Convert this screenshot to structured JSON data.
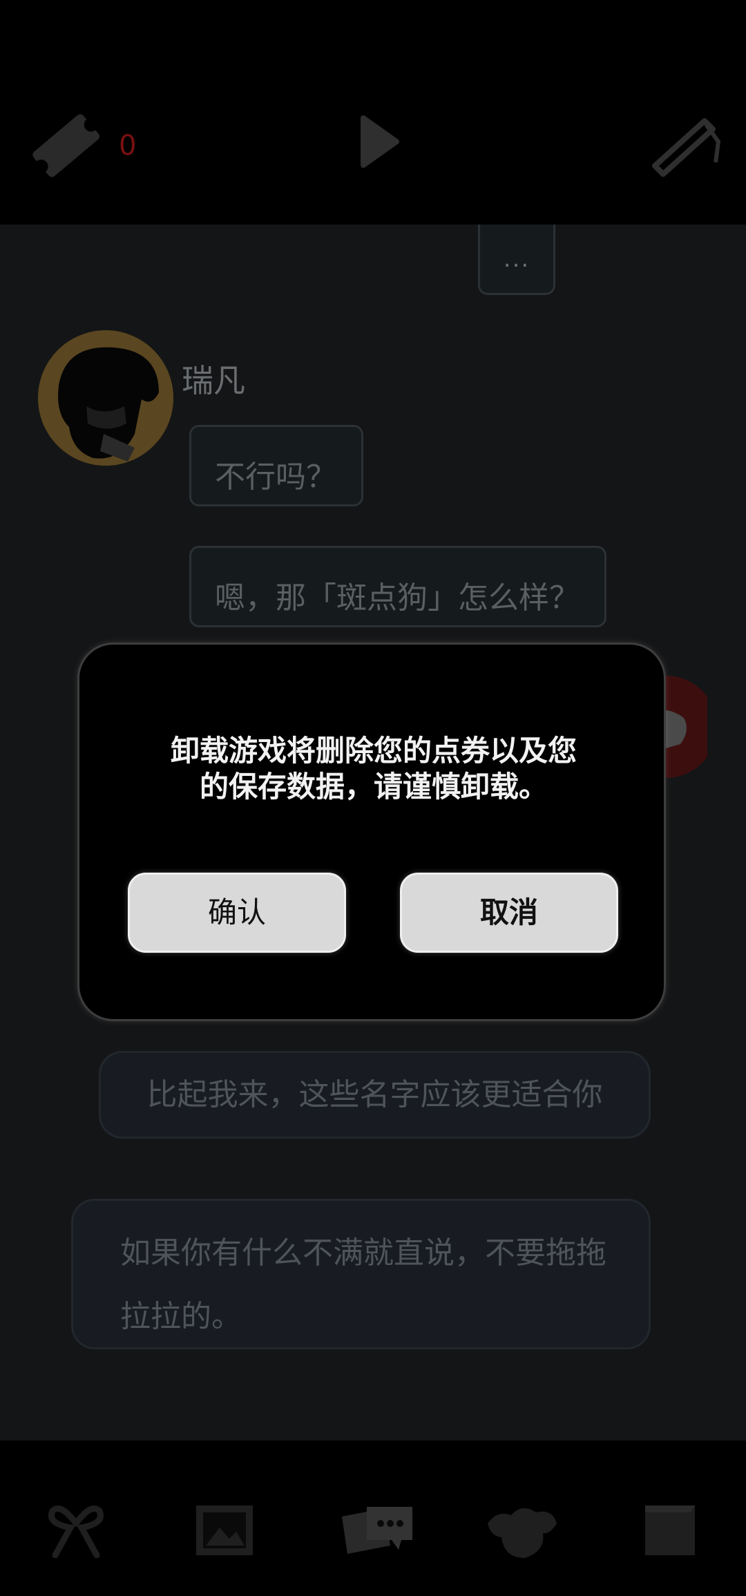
{
  "top_bar": {
    "ticket_count": "0",
    "icons": [
      "ticket-icon",
      "play-icon",
      "brush-icon"
    ]
  },
  "chat": {
    "typing_indicator": "...",
    "speaker_name": "瑞凡",
    "messages": [
      "不行吗？",
      "嗯，那「斑点狗」怎么样？"
    ],
    "options": [
      "比起我来，这些名字应该更适合你",
      "如果你有什么不满就直说，不要拖拖拉拉的。"
    ]
  },
  "dialog": {
    "message_line1": "卸载游戏将删除您的点券以及您",
    "message_line2": "的保存数据，请谨慎卸载。",
    "confirm_label": "确认",
    "cancel_label": "取消"
  },
  "bottom_nav": {
    "icons": [
      "ribbon-icon",
      "gallery-icon",
      "chat-icon",
      "character-icon",
      "notes-icon"
    ]
  }
}
